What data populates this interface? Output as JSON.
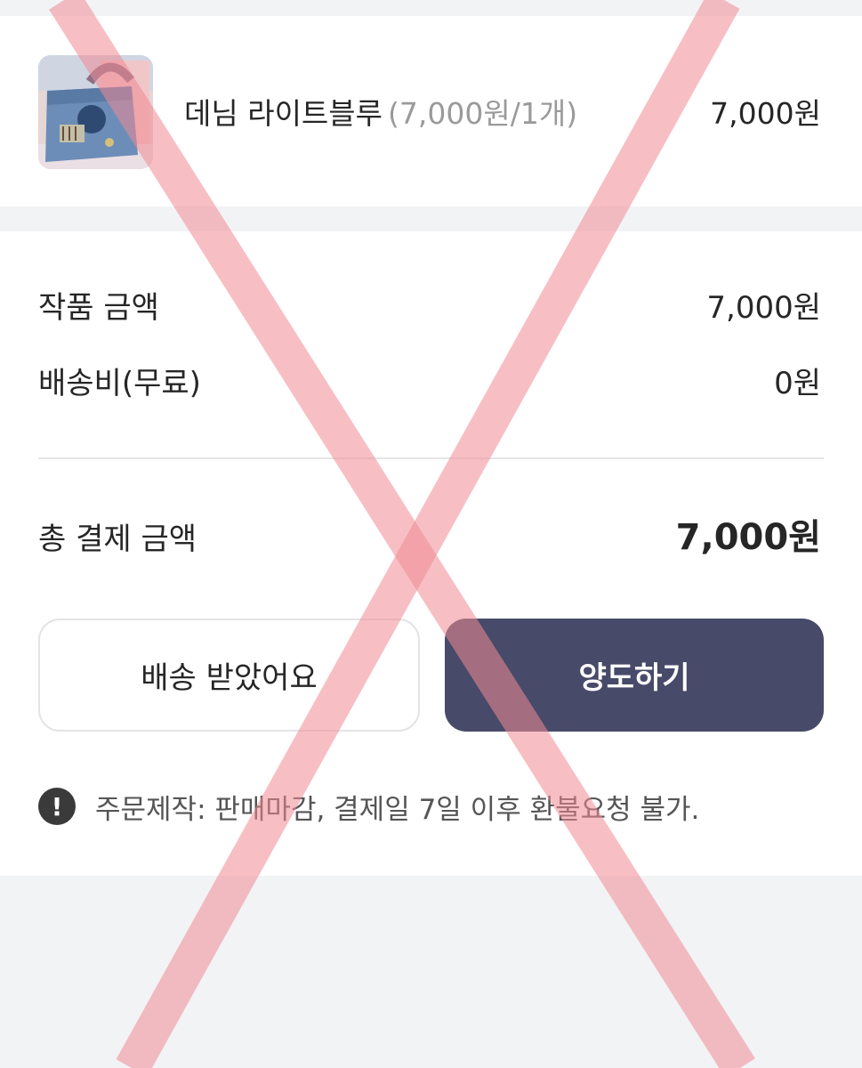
{
  "product": {
    "name": "데님 라이트블루",
    "detail": "(7,000원/1개)",
    "price": "7,000원",
    "thumbnail_icon": "denim-bag-photo"
  },
  "summary": {
    "item_amount_label": "작품 금액",
    "item_amount_value": "7,000원",
    "shipping_label": "배송비(무료)",
    "shipping_value": "0원",
    "total_label": "총 결제 금액",
    "total_value": "7,000원"
  },
  "actions": {
    "received_label": "배송 받았어요",
    "transfer_label": "양도하기"
  },
  "notice": {
    "icon": "exclamation-icon",
    "icon_glyph": "!",
    "text": "주문제작: 판매마감, 결제일 7일 이후 환불요청 불가."
  },
  "colors": {
    "primary_button": "#474a68",
    "page_background": "#f2f3f5",
    "watermark_x": "#f08a94"
  }
}
